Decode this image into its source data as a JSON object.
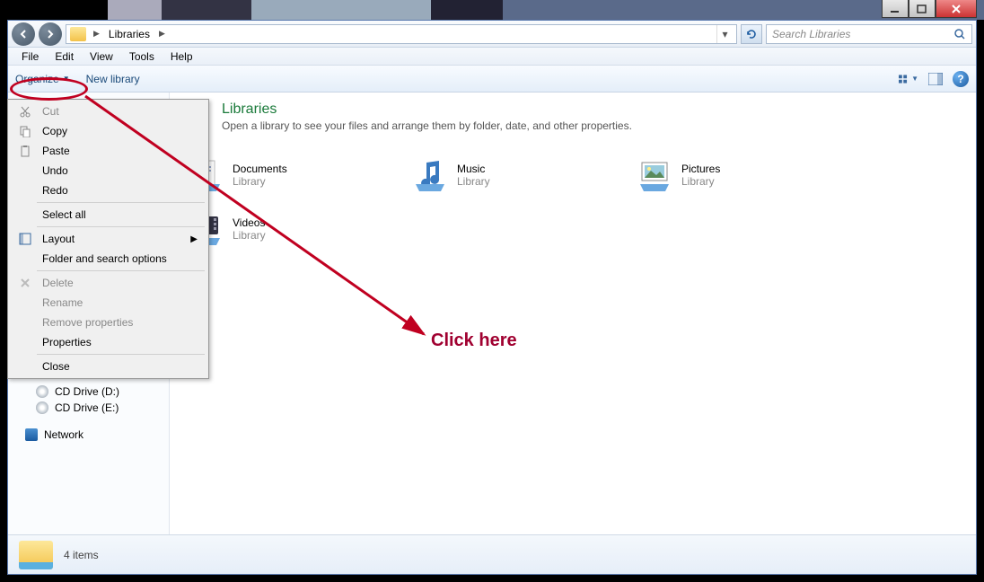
{
  "titlebar": {
    "min": "minimize",
    "max": "maximize",
    "close": "close"
  },
  "nav": {
    "breadcrumb_root": "Libraries",
    "search_placeholder": "Search Libraries"
  },
  "menubar": [
    "File",
    "Edit",
    "View",
    "Tools",
    "Help"
  ],
  "toolbar": {
    "organize": "Organize",
    "newlib": "New library"
  },
  "dropdown": {
    "items": [
      {
        "label": "Cut",
        "icon": "scissors",
        "disabled": true
      },
      {
        "label": "Copy",
        "icon": "copy",
        "disabled": false
      },
      {
        "label": "Paste",
        "icon": "paste",
        "disabled": false
      },
      {
        "label": "Undo",
        "icon": "",
        "disabled": false
      },
      {
        "label": "Redo",
        "icon": "",
        "disabled": false
      },
      {
        "sep": true
      },
      {
        "label": "Select all",
        "icon": "",
        "disabled": false
      },
      {
        "sep": true
      },
      {
        "label": "Layout",
        "icon": "layout",
        "disabled": false,
        "submenu": true
      },
      {
        "label": "Folder and search options",
        "icon": "",
        "disabled": false
      },
      {
        "sep": true
      },
      {
        "label": "Delete",
        "icon": "delete",
        "disabled": true
      },
      {
        "label": "Rename",
        "icon": "",
        "disabled": true
      },
      {
        "label": "Remove properties",
        "icon": "",
        "disabled": true
      },
      {
        "label": "Properties",
        "icon": "",
        "disabled": false
      },
      {
        "sep": true
      },
      {
        "label": "Close",
        "icon": "",
        "disabled": false
      }
    ]
  },
  "content": {
    "title": "Libraries",
    "subtitle": "Open a library to see your files and arrange them by folder, date, and other properties.",
    "items": [
      {
        "name": "Documents",
        "type": "Library",
        "icon": "documents"
      },
      {
        "name": "Music",
        "type": "Library",
        "icon": "music"
      },
      {
        "name": "Pictures",
        "type": "Library",
        "icon": "pictures"
      },
      {
        "name": "Videos",
        "type": "Library",
        "icon": "videos"
      }
    ]
  },
  "sidebar": {
    "cd1": "CD Drive (D:)",
    "cd2": "CD Drive (E:)",
    "network": "Network"
  },
  "statusbar": {
    "text": "4 items"
  },
  "annotation": {
    "text": "Click here"
  }
}
